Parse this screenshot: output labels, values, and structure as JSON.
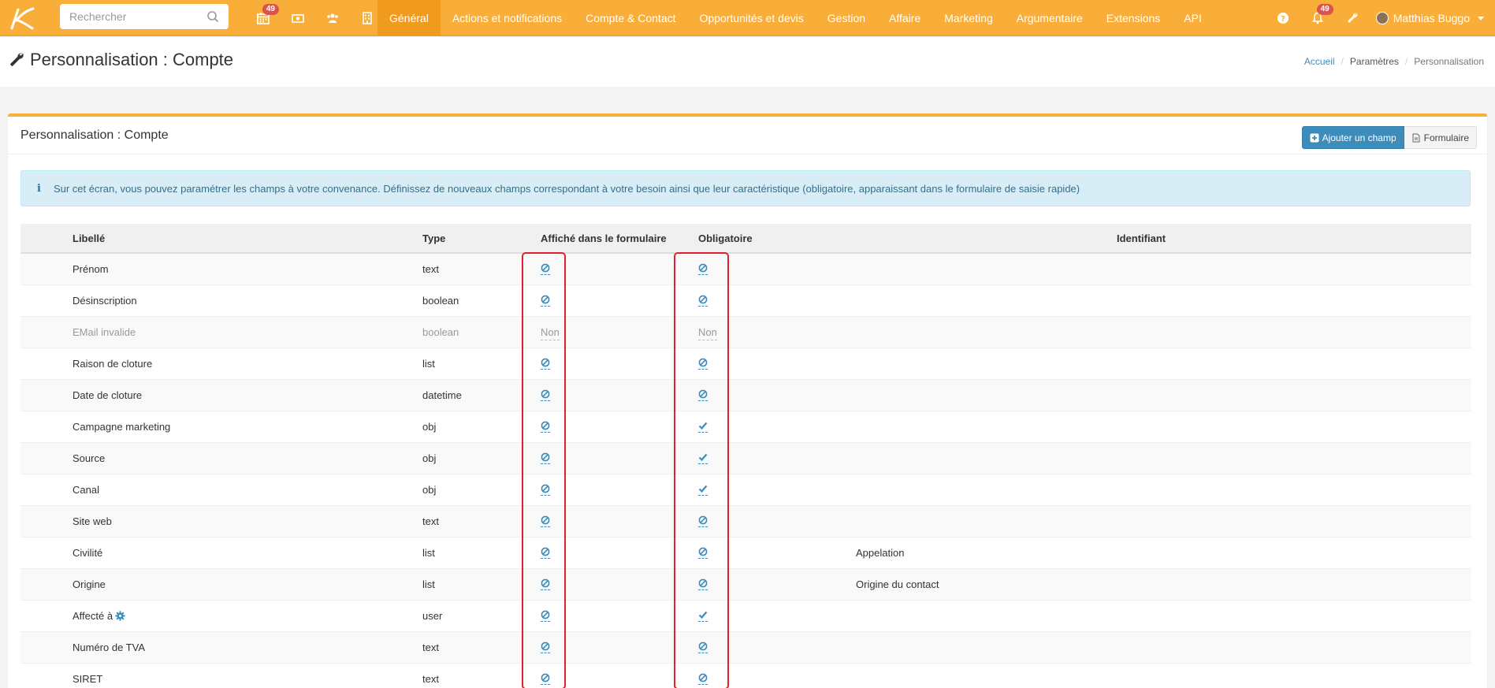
{
  "nav": {
    "search_placeholder": "Rechercher",
    "icons": [
      {
        "name": "calendar-icon",
        "badge": "49"
      },
      {
        "name": "money-icon",
        "badge": ""
      },
      {
        "name": "users-icon",
        "badge": ""
      },
      {
        "name": "building-icon",
        "badge": ""
      }
    ],
    "menu": [
      {
        "label": "Général",
        "active": true
      },
      {
        "label": "Actions et notifications"
      },
      {
        "label": "Compte & Contact"
      },
      {
        "label": "Opportunités et devis"
      },
      {
        "label": "Gestion"
      },
      {
        "label": "Affaire"
      },
      {
        "label": "Marketing"
      },
      {
        "label": "Argumentaire"
      },
      {
        "label": "Extensions"
      },
      {
        "label": "API"
      }
    ],
    "notif_badge": "49",
    "user_name": "Matthias Buggo"
  },
  "page": {
    "title": "Personnalisation : Compte",
    "breadcrumb": [
      "Accueil",
      "Paramètres",
      "Personnalisation"
    ]
  },
  "box": {
    "title": "Personnalisation : Compte",
    "add_field_label": "Ajouter un champ",
    "form_label": "Formulaire",
    "alert_text": "Sur cet écran, vous pouvez paramétrer les champs à votre convenance. Définissez de nouveaux champs correspondant à votre besoin ainsi que leur caractéristique (obligatoire, apparaissant dans le formulaire de saisie rapide)"
  },
  "table": {
    "headers": [
      "Libellé",
      "Type",
      "Affiché dans le formulaire",
      "Obligatoire",
      "Identifiant"
    ],
    "rows": [
      {
        "label": "Prénom",
        "type": "text",
        "shown": "ban",
        "required": "ban",
        "id": ""
      },
      {
        "label": "Désinscription",
        "type": "boolean",
        "shown": "ban",
        "required": "ban",
        "id": ""
      },
      {
        "label": "EMail invalide",
        "type": "boolean",
        "shown": "Non",
        "required": "Non",
        "id": "",
        "muted": true
      },
      {
        "label": "Raison de cloture",
        "type": "list",
        "shown": "ban",
        "required": "ban",
        "id": ""
      },
      {
        "label": "Date de cloture",
        "type": "datetime",
        "shown": "ban",
        "required": "ban",
        "id": ""
      },
      {
        "label": "Campagne marketing",
        "type": "obj",
        "shown": "ban",
        "required": "check",
        "id": ""
      },
      {
        "label": "Source",
        "type": "obj",
        "shown": "ban",
        "required": "check",
        "id": ""
      },
      {
        "label": "Canal",
        "type": "obj",
        "shown": "ban",
        "required": "check",
        "id": ""
      },
      {
        "label": "Site web",
        "type": "text",
        "shown": "ban",
        "required": "ban",
        "id": ""
      },
      {
        "label": "Civilité",
        "type": "list",
        "shown": "ban",
        "required": "ban",
        "id": "Appelation"
      },
      {
        "label": "Origine",
        "type": "list",
        "shown": "ban",
        "required": "ban",
        "id": "Origine du contact"
      },
      {
        "label": "Affecté à",
        "type": "user",
        "shown": "ban",
        "required": "check",
        "id": "",
        "gear": true
      },
      {
        "label": "Numéro de TVA",
        "type": "text",
        "shown": "ban",
        "required": "ban",
        "id": ""
      },
      {
        "label": "SIRET",
        "type": "text",
        "shown": "ban",
        "required": "ban",
        "id": ""
      }
    ]
  },
  "colors": {
    "accent": "#f9ae3a",
    "primary": "#3c8dbc",
    "highlight": "#e0202e"
  }
}
